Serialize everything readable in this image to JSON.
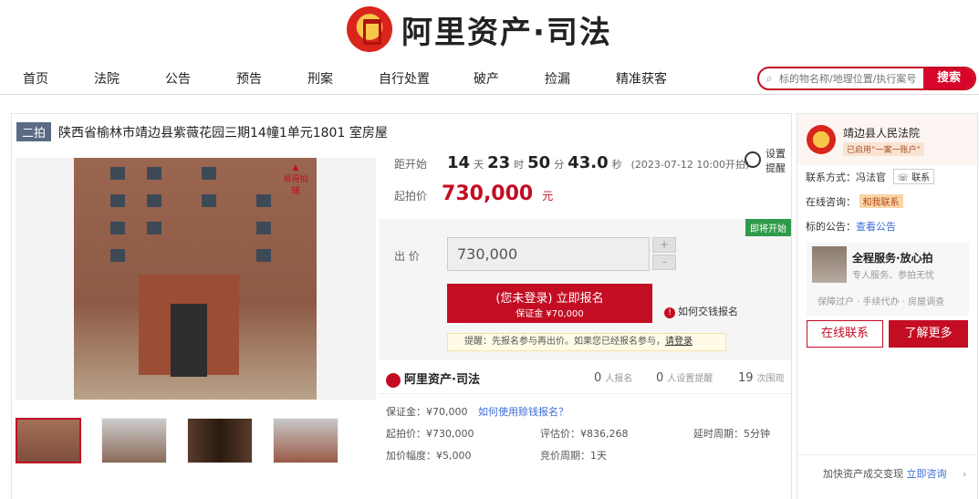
{
  "header": {
    "logo_text": "阿里资产·司法"
  },
  "nav": {
    "items": [
      "首页",
      "法院",
      "公告",
      "预告",
      "刑案",
      "自行处置",
      "破产",
      "捡漏",
      "精准获客"
    ]
  },
  "search": {
    "placeholder": "标的物名称/地理位置/执行案号",
    "button": "搜索"
  },
  "lot": {
    "tag": "二拍",
    "title": "陕西省榆林市靖边县紫薇花园三期14幢1单元1801 室房屋",
    "watermark": "易得拍辅"
  },
  "countdown": {
    "label": "距开始",
    "days": "14",
    "days_u": "天",
    "hours": "23",
    "hours_u": "时",
    "mins": "50",
    "mins_u": "分",
    "secs": "43.0",
    "secs_u": "秒",
    "start_note": "(2023-07-12 10:00开拍)"
  },
  "remind": {
    "line1": "设置",
    "line2": "提醒"
  },
  "start_price": {
    "label": "起拍价",
    "value": "730,000",
    "unit": "元"
  },
  "bid": {
    "soon_badge": "即将开始",
    "label": "出  价",
    "value": "730,000",
    "plus": "+",
    "minus": "-",
    "signup_line1": "(您未登录) 立即报名",
    "signup_line2": "保证金 ¥70,000",
    "howpay": "如何交钱报名",
    "tip_text": "提醒：先报名参与再出价。如果您已经报名参与，",
    "tip_link": "请登录"
  },
  "stats": {
    "brand": "阿里资产·司法",
    "signup_n": "0",
    "signup_l": "人报名",
    "remind_n": "0",
    "remind_l": "人设置提醒",
    "view_n": "19",
    "view_l": "次围观"
  },
  "details": {
    "deposit": "保证金：¥70,000",
    "deposit_link": "如何使用赊钱报名？",
    "start_price": "起拍价：¥730,000",
    "eval_price": "评估价：¥836,268",
    "delay": "延时周期：5分钟",
    "increment": "加价幅度：¥5,000",
    "period": "竞价周期：1天"
  },
  "court": {
    "name": "靖边县人民法院",
    "badge": "已启用“一案一账户”",
    "contact_label": "联系方式：",
    "contact_name": "冯法官",
    "contact_btn": "联系",
    "online_label": "在线咨询：",
    "online_btn": "和我联系",
    "notice_label": "标的公告：",
    "notice_link": "查看公告"
  },
  "service": {
    "title": "全程服务·放心拍",
    "subtitle": "专人服务、参拍无忧",
    "features": "保障过户 · 手续代办 · 房屋调查"
  },
  "actions": {
    "online": "在线联系",
    "more": "了解更多"
  },
  "footer": {
    "text": "加快资产成交变现",
    "link": "立即咨询"
  },
  "colors": {
    "brand_red": "#c30d23",
    "link_blue": "#3b6bd6",
    "soon_green": "#2f9a4a"
  }
}
